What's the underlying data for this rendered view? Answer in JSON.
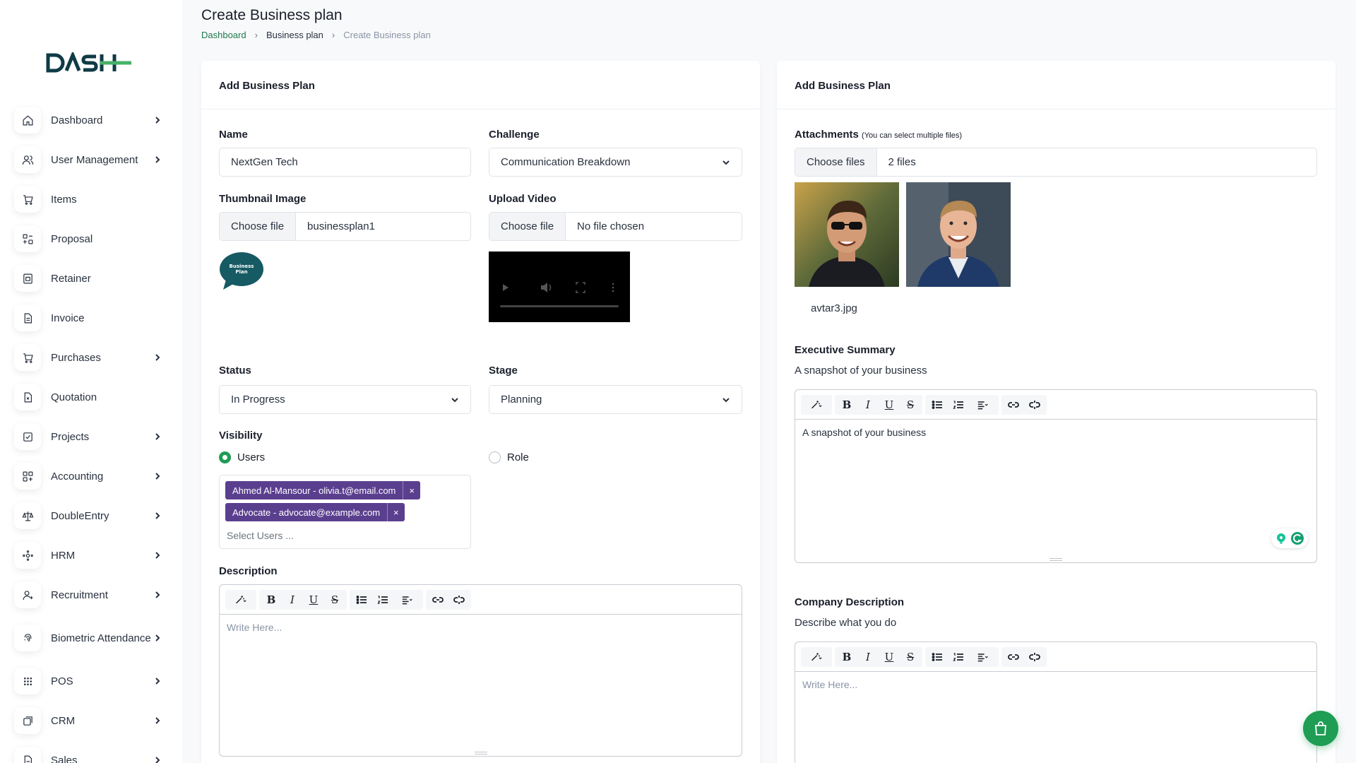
{
  "header": {
    "title": "Create Business plan",
    "breadcrumb": [
      "Dashboard",
      "Business plan",
      "Create Business plan"
    ]
  },
  "sidebar": {
    "logo_main": "DASH",
    "items": [
      {
        "label": "Dashboard",
        "icon": "home-icon",
        "chevron": true
      },
      {
        "label": "User Management",
        "icon": "users-icon",
        "chevron": true
      },
      {
        "label": "Items",
        "icon": "cart-icon",
        "chevron": false
      },
      {
        "label": "Proposal",
        "icon": "proposal-icon",
        "chevron": false
      },
      {
        "label": "Retainer",
        "icon": "retainer-icon",
        "chevron": false
      },
      {
        "label": "Invoice",
        "icon": "invoice-icon",
        "chevron": false
      },
      {
        "label": "Purchases",
        "icon": "cart-icon",
        "chevron": true
      },
      {
        "label": "Quotation",
        "icon": "quotation-icon",
        "chevron": false
      },
      {
        "label": "Projects",
        "icon": "projects-icon",
        "chevron": true
      },
      {
        "label": "Accounting",
        "icon": "accounting-icon",
        "chevron": true
      },
      {
        "label": "DoubleEntry",
        "icon": "scale-icon",
        "chevron": true
      },
      {
        "label": "HRM",
        "icon": "hrm-icon",
        "chevron": true
      },
      {
        "label": "Recruitment",
        "icon": "recruitment-icon",
        "chevron": true
      },
      {
        "label": "Biometric Attendance",
        "icon": "fingerprint-icon",
        "chevron": true
      },
      {
        "label": "POS",
        "icon": "grid-icon",
        "chevron": true
      },
      {
        "label": "CRM",
        "icon": "crm-icon",
        "chevron": true
      },
      {
        "label": "Sales",
        "icon": "sales-icon",
        "chevron": true
      }
    ]
  },
  "left_card": {
    "title": "Add Business Plan",
    "name_label": "Name",
    "name_value": "NextGen Tech",
    "challenge_label": "Challenge",
    "challenge_value": "Communication Breakdown",
    "thumbnail_label": "Thumbnail Image",
    "thumbnail_button": "Choose file",
    "thumbnail_file": "businessplan1",
    "thumbnail_logo_text": "Business Plan",
    "video_label": "Upload Video",
    "video_button": "Choose file",
    "video_file": "No file chosen",
    "status_label": "Status",
    "status_value": "In Progress",
    "stage_label": "Stage",
    "stage_value": "Planning",
    "visibility_label": "Visibility",
    "visibility_options": [
      "Users",
      "Role"
    ],
    "visibility_selected": "Users",
    "selected_users": [
      "Ahmed Al-Mansour - olivia.t@email.com",
      "Advocate - advocate@example.com"
    ],
    "users_placeholder": "Select Users ...",
    "description_label": "Description",
    "description_placeholder": "Write Here..."
  },
  "right_card": {
    "title": "Add Business Plan",
    "attachments_label": "Attachments",
    "attachments_hint": "(You can select multiple files)",
    "attachments_button": "Choose files",
    "attachments_count": "2 files",
    "attachment_caption": "avtar3.jpg",
    "exec_summary_label": "Executive Summary",
    "exec_summary_help": "A snapshot of your business",
    "exec_summary_value": "A snapshot of your business",
    "company_desc_label": "Company Description",
    "company_desc_help": "Describe what you do",
    "company_desc_placeholder": "Write Here..."
  },
  "editor_toolbar": [
    "magic",
    "B",
    "I",
    "U",
    "S",
    "ul",
    "ol",
    "align",
    "link",
    "unlink"
  ],
  "colors": {
    "accent": "#1f9d55",
    "tag": "#5b3f8f",
    "breadcrumb_link": "#1f7a4d"
  }
}
